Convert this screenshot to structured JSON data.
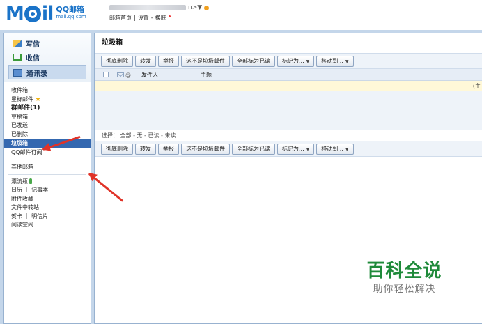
{
  "header": {
    "logo_text": "M",
    "logo_text2": "il",
    "logo_zh": "QQ邮箱",
    "logo_en": "mail.qq.com",
    "account_tail": "n>▼",
    "links": [
      "邮箱首页",
      "|",
      "设置",
      "-",
      "换肤"
    ]
  },
  "sidebar": {
    "quick": [
      {
        "label": "写信",
        "icon": "pencil-icon"
      },
      {
        "label": "收信",
        "icon": "inbox-icon"
      },
      {
        "label": "通讯录",
        "icon": "contacts-icon"
      }
    ],
    "folders": {
      "inbox": "收件箱",
      "starred": "星标邮件",
      "group": "群邮件(1)",
      "drafts": "草稿箱",
      "sent": "已发送",
      "deleted": "已删除",
      "spam": "垃圾箱",
      "subscriptions": "QQ邮件订阅",
      "other": "其他邮箱",
      "bottle": "漂流瓶",
      "calendar": "日历 ｜ 记事本",
      "attachments": "附件收藏",
      "transfer": "文件中转站",
      "cards": "贺卡 ｜ 明信片",
      "reading": "阅读空间"
    }
  },
  "main": {
    "title": "垃圾箱",
    "toolbar": {
      "delete_forever": "彻底删除",
      "forward": "转发",
      "report": "举报",
      "not_spam": "这不是垃圾邮件",
      "mark_all_read": "全部标为已读",
      "mark_as": "标记为...",
      "move_to": "移动到..."
    },
    "columns": {
      "attach_mark": "@",
      "from": "发件人",
      "subject": "主题"
    },
    "notice_text": "(主",
    "select_row": "选择： 全部 - 无 - 已读 - 未读"
  },
  "watermark": {
    "title": "百科全说",
    "subtitle": "助你轻松解决"
  }
}
